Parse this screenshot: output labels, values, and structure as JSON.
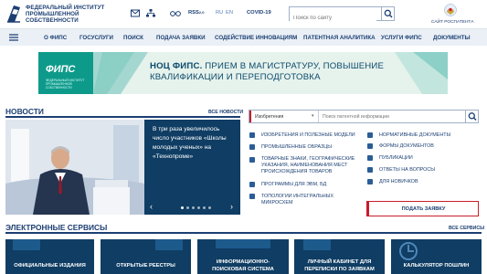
{
  "header": {
    "org_name_lines": [
      "ФЕДЕРАЛЬНЫЙ ИНСТИТУТ",
      "ПРОМЫШЛЕННОЙ",
      "СОБСТВЕННОСТИ"
    ],
    "rss": "RSS",
    "rss_sub": "2.0",
    "lang_ru": "RU",
    "lang_en": "EN",
    "covid": "COVID-19",
    "search_placeholder": "Поиск по сайту",
    "ros_label": "САЙТ РОСПАТЕНТА"
  },
  "nav": {
    "items": [
      "О ФИПС",
      "ГОСУСЛУГИ",
      "ПОИСК",
      "ПОДАЧА ЗАЯВКИ",
      "СОДЕЙСТВИЕ ИННОВАЦИЯМ",
      "ПАТЕНТНАЯ АНАЛИТИКА",
      "УСЛУГИ ФИПС",
      "ДОКУМЕНТЫ"
    ]
  },
  "banner": {
    "logo_text": "ФИПС",
    "logo_sub": "ФЕДЕРАЛЬНЫЙ ИНСТИТУТ ПРОМЫШЛЕННОЙ СОБСТВЕННОСТИ",
    "headline_bold": "НОЦ ФИПС.",
    "headline_line1": " ПРИЕМ В МАГИСТРАТУРУ, ПОВЫШЕНИЕ",
    "headline_line2": "КВАЛИФИКАЦИИ И ПЕРЕПОДГОТОВКА"
  },
  "news": {
    "title": "НОВОСТИ",
    "all_link": "ВСЕ НОВОСТИ",
    "card_text": "В три раза увеличилось число участников «Школы молодых ученых» на «Технопроме»",
    "prev": "‹",
    "next": "›",
    "slides": 6,
    "active_slide": 1
  },
  "patent_search": {
    "select_value": "Изобретения",
    "placeholder": "Поиск патентной информации"
  },
  "links_left": [
    "ИЗОБРЕТЕНИЯ И ПОЛЕЗНЫЕ МОДЕЛИ",
    "ПРОМЫШЛЕННЫЕ ОБРАЗЦЫ",
    "ТОВАРНЫЕ ЗНАКИ, ГЕОГРАФИЧЕСКИЕ УКАЗАНИЯ, НАИМЕНОВАНИЯ МЕСТ ПРОИСХОЖДЕНИЯ ТОВАРОВ",
    "ПРОГРАММЫ ДЛЯ ЭВМ, БД",
    "ТОПОЛОГИИ ИНТЕГРАЛЬНЫХ МИКРОСХЕМ"
  ],
  "links_right": [
    "НОРМАТИВНЫЕ ДОКУМЕНТЫ",
    "ФОРМЫ ДОКУМЕНТОВ",
    "ПУБЛИКАЦИИ",
    "ОТВЕТЫ НА ВОПРОСЫ",
    "ДЛЯ НОВИЧКОВ"
  ],
  "apply_button": "ПОДАТЬ ЗАЯВКУ",
  "services": {
    "title": "ЭЛЕКТРОННЫЕ СЕРВИСЫ",
    "all_link": "ВСЕ СЕРВИСЫ",
    "items": [
      "ОФИЦИАЛЬНЫЕ ИЗДАНИЯ",
      "ОТКРЫТЫЕ РЕЕСТРЫ",
      "ИНФОРМАЦИОННО-\nПОИСКОВАЯ СИСТЕМА",
      "ЛИЧНЫЙ КАБИНЕТ ДЛЯ\nПЕРЕПИСКИ ПО ЗАЯВКАМ",
      "КАЛЬКУЛЯТОР ПОШЛИН"
    ]
  },
  "colors": {
    "brand": "#1c3f73",
    "accent_red": "#c91b2b",
    "card_navy": "#0f3d63",
    "banner_teal": "#0e9a8a"
  }
}
